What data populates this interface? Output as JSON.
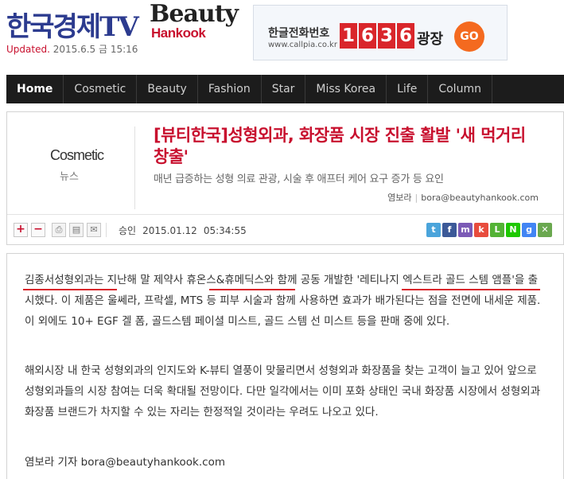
{
  "header": {
    "logo_main": "한국경제TV",
    "logo_beauty": "Beauty",
    "logo_hankook": "Hankook",
    "updated_label": "Updated.",
    "updated_date": "2015.6.5 금 15:16"
  },
  "ad": {
    "line1": "한글전화번호",
    "line2": "www.callpia.co.kr",
    "digits": [
      "1",
      "6",
      "3",
      "6"
    ],
    "gwang": "광장",
    "go": "GO"
  },
  "nav": {
    "items": [
      "Home",
      "Cosmetic",
      "Beauty",
      "Fashion",
      "Star",
      "Miss Korea",
      "Life",
      "Column"
    ],
    "active": "Home"
  },
  "article": {
    "category_en": "Cosmetic",
    "category_ko": "뉴스",
    "title": "[뷰티한국]성형외과, 화장품 시장 진출 활발 '새 먹거리 창출'",
    "subtitle": "매년 급증하는 성형 의료 관광, 시술 후 애프터 케어 요구 증가 등 요인",
    "author": "염보라",
    "email": "bora@beautyhankook.com",
    "posted_label": "승인",
    "posted_date": "2015.01.12",
    "posted_time": "05:34:55",
    "paragraph1": "김종서성형외과는 지난해 말 제약사 휴온스&휴메딕스와 함께 공동 개발한 '레티나지 엑스트라 골드 스템 앰플'을 출시했다. 이 제품은 울쎄라, 프락셀, MTS 등 피부 시술과 함께 사용하면 효과가 배가된다는 점을 전면에 내세운 제품. 이 외에도 10+ EGF 겔 폼, 골드스템 페이셜 미스트, 골드 스템 선 미스트 등을 판매 중에 있다.",
    "paragraph2": "해외시장 내 한국 성형외과의 인지도와 K-뷰티 열풍이 맞물리면서 성형외과 화장품을 찾는 고객이 늘고 있어 앞으로 성형외과들의 시장 참여는 더욱 확대될 전망이다. 다만 일각에서는 이미 포화 상태인 국내 화장품 시장에서 성형외과 화장품 브랜드가 차지할 수 있는 자리는 한정적일 것이라는 우려도 나오고 있다.",
    "reporter_line": "염보라 기자 bora@beautyhankook.com"
  },
  "toolbar": {
    "font_plus": "+",
    "font_minus": "−",
    "icons": [
      "print-icon",
      "save-icon",
      "email-icon"
    ]
  },
  "share": {
    "buttons": [
      {
        "name": "twitter",
        "label": "t",
        "color": "#4aa4db"
      },
      {
        "name": "facebook",
        "label": "f",
        "color": "#3b5998"
      },
      {
        "name": "me2day",
        "label": "m",
        "color": "#7b5ab6"
      },
      {
        "name": "kakao",
        "label": "k",
        "color": "#e84c3d"
      },
      {
        "name": "line",
        "label": "L",
        "color": "#53b335"
      },
      {
        "name": "naver",
        "label": "N",
        "color": "#1ec800"
      },
      {
        "name": "google",
        "label": "g",
        "color": "#4285f4"
      },
      {
        "name": "bookmark",
        "label": "✕",
        "color": "#6aa84f"
      }
    ]
  },
  "colors": {
    "accent": "#c8102e",
    "nav_bg": "#1c1c1c",
    "underline": "#d9262b"
  }
}
